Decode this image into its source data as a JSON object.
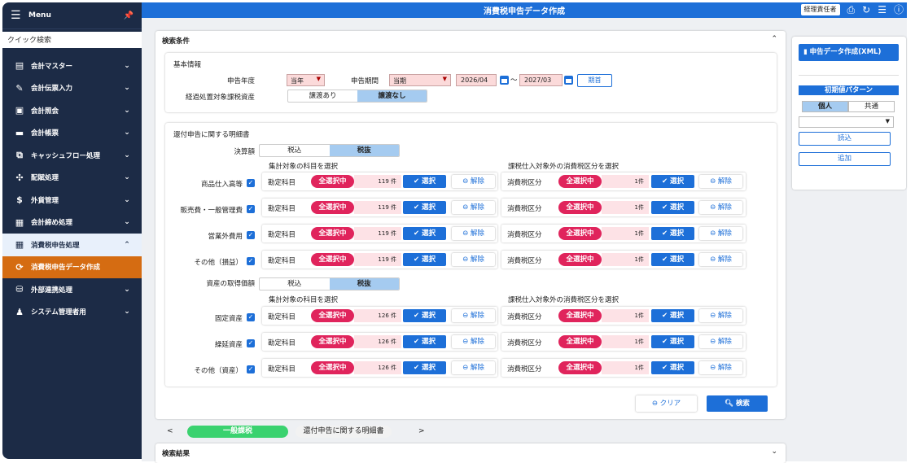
{
  "sidebar": {
    "menu_label": "Menu",
    "quick_search": "クイック検索",
    "items": [
      {
        "label": "会計マスター",
        "icon": "clipboard-icon"
      },
      {
        "label": "会計伝票入力",
        "icon": "pen-icon"
      },
      {
        "label": "会計照会",
        "icon": "doc-search-icon"
      },
      {
        "label": "会計帳票",
        "icon": "report-icon"
      },
      {
        "label": "キャッシュフロー処理",
        "icon": "cashflow-icon"
      },
      {
        "label": "配賦処理",
        "icon": "distribution-icon"
      },
      {
        "label": "外貨管理",
        "icon": "dollar-icon"
      },
      {
        "label": "会計締め処理",
        "icon": "calendar-lock-icon"
      },
      {
        "label": "消費税申告処理",
        "icon": "grid-icon"
      },
      {
        "label": "消費税申告データ作成",
        "icon": "sync-icon"
      },
      {
        "label": "外部連携処理",
        "icon": "database-icon"
      },
      {
        "label": "システム管理者用",
        "icon": "admin-icon"
      }
    ]
  },
  "topbar": {
    "title": "消費税申告データ作成",
    "role": "経理責任者"
  },
  "search": {
    "header": "検索条件",
    "basic": {
      "title": "基本情報",
      "year_label": "申告年度",
      "year_value": "当年",
      "period_label": "申告期間",
      "period_value": "当期",
      "date_from": "2026/04",
      "tilde": "〜",
      "date_to": "2027/03",
      "period_start_btn": "期首",
      "transitional_label": "経過処置対象課税資産",
      "transfer_yes": "譲渡あり",
      "transfer_no": "譲渡なし"
    },
    "detail": {
      "title": "還付申告に関する明細書",
      "settlement_label": "決算額",
      "tax_in": "税込",
      "tax_out": "税抜",
      "subtitle_accounts": "集計対象の科目を選択",
      "subtitle_tax": "課税仕入対象外の消費税区分を選択",
      "asset_label": "資産の取得価額",
      "account_label": "勘定科目",
      "tax_cat_label": "消費税区分",
      "all_selected": "全選択中",
      "select_btn": "選択",
      "clear_btn": "解除",
      "rows_top": [
        {
          "label": "商品仕入高等",
          "acc_count": "119 件",
          "tax_count": "1件"
        },
        {
          "label": "販売費・一般管理費",
          "acc_count": "119 件",
          "tax_count": "1件"
        },
        {
          "label": "営業外費用",
          "acc_count": "119 件",
          "tax_count": "1件"
        },
        {
          "label": "その他（損益）",
          "acc_count": "119 件",
          "tax_count": "1件"
        }
      ],
      "rows_bottom": [
        {
          "label": "固定資産",
          "acc_count": "126 件",
          "tax_count": "1件"
        },
        {
          "label": "繰延資産",
          "acc_count": "126 件",
          "tax_count": "1件"
        },
        {
          "label": "その他（資産）",
          "acc_count": "126 件",
          "tax_count": "1件"
        }
      ]
    },
    "clear_button": "クリア",
    "search_button": "検索"
  },
  "pager": {
    "prev": "<",
    "tab1": "一般課税",
    "tab2": "還付申告に関する明細書",
    "next": ">"
  },
  "results_header": "検索結果",
  "side": {
    "xml_button": "申告データ作成(XML)",
    "pattern_title": "初期値パターン",
    "tab_personal": "個人",
    "tab_common": "共通",
    "load_button": "読込",
    "add_button": "追加"
  },
  "colors": {
    "sidebar": "#1c2b46",
    "primary": "#1d6fd8",
    "accent": "#d56c12",
    "pill": "#e0245c"
  }
}
